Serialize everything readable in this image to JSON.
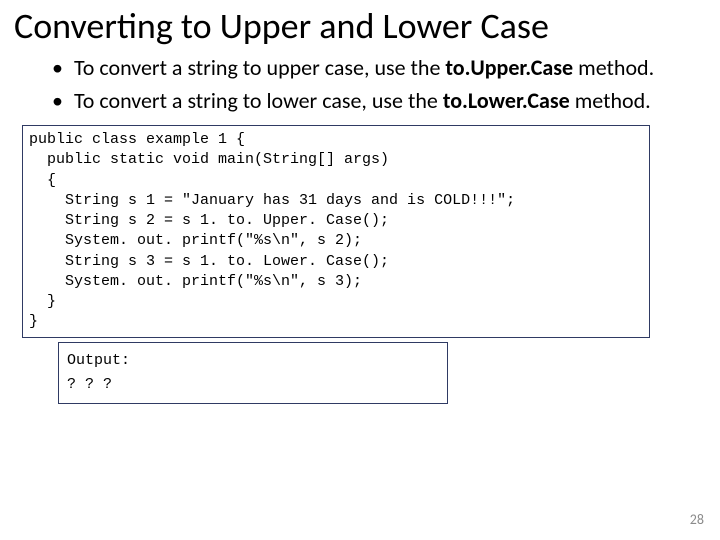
{
  "slide": {
    "title": "Converting to Upper and Lower Case",
    "bullets": [
      {
        "pre": "To convert a string to upper case, use the ",
        "method": "to.Upper.Case",
        "post": " method."
      },
      {
        "pre": "To convert a string to lower case, use the ",
        "method": "to.Lower.Case",
        "post": " method."
      }
    ],
    "code": "public class example 1 {\n  public static void main(String[] args)\n  {\n    String s 1 = \"January has 31 days and is COLD!!!\";\n    String s 2 = s 1. to. Upper. Case();\n    System. out. printf(\"%s\\n\", s 2);\n    String s 3 = s 1. to. Lower. Case();\n    System. out. printf(\"%s\\n\", s 3);\n  }\n}",
    "output_label": "Output:",
    "output_value": "? ? ?",
    "page_number": "28"
  }
}
